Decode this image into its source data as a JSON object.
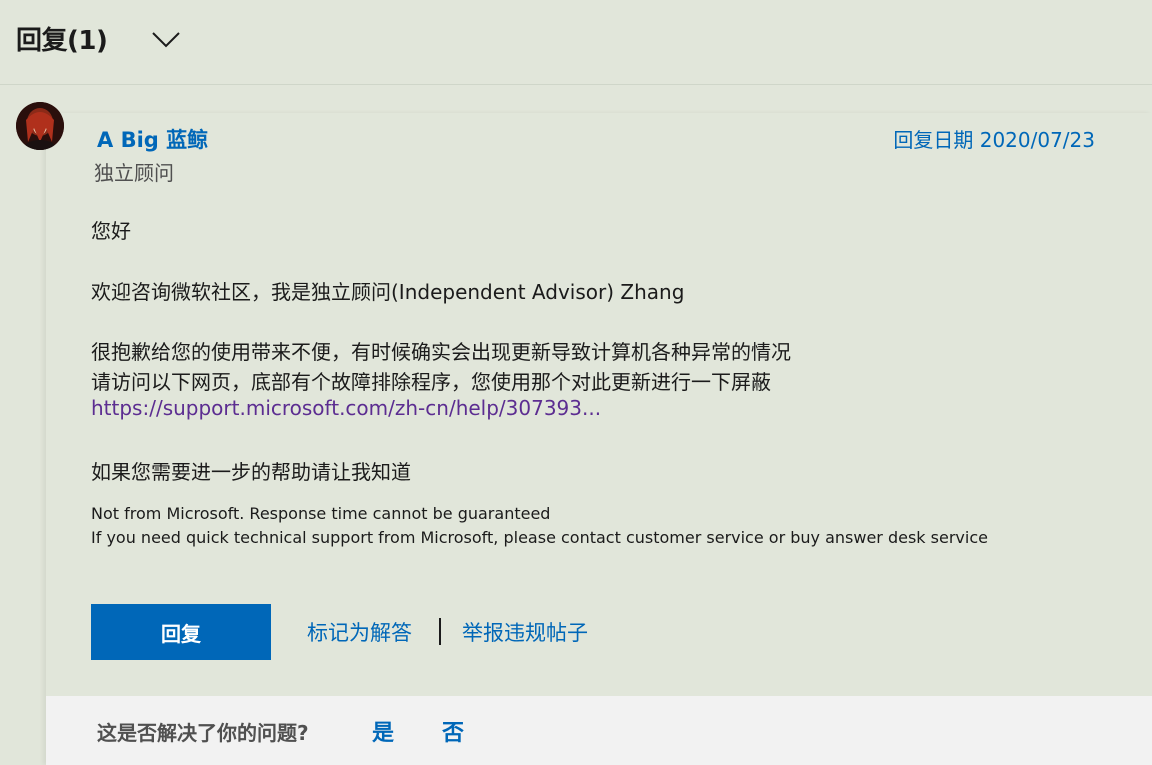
{
  "header": {
    "title": "回复(1)",
    "toggle_icon": "chevron-down-icon"
  },
  "post": {
    "author": "A Big 蓝鲸",
    "role": "独立顾问",
    "date": "回复日期 2020/07/23",
    "avatar_icon": "avatar-image",
    "lines": {
      "greeting": "您好",
      "intro": "欢迎咨询微软社区，我是独立顾问(Independent Advisor) Zhang",
      "apology": "很抱歉给您的使用带来不便，有时候确实会出现更新导致计算机各种异常的情况",
      "instruction": "请访问以下网页，底部有个故障排除程序，您使用那个对此更新进行一下屏蔽",
      "link": "https://support.microsoft.com/zh-cn/help/307393...",
      "closing": "如果您需要进一步的帮助请让我知道"
    },
    "disclaimer": {
      "line1": "Not from Microsoft. Response time cannot be guaranteed",
      "line2": "If you need quick technical support from Microsoft, please contact customer service or buy answer desk service"
    }
  },
  "actions": {
    "reply_label": "回复",
    "mark_answer_label": "标记为解答",
    "report_label": "举报违规帖子"
  },
  "feedback": {
    "question": "这是否解决了你的问题?",
    "yes_label": "是",
    "no_label": "否"
  },
  "colors": {
    "page_bg": "#e1e6da",
    "accent": "#0067b8",
    "link_visited": "#5c2d91",
    "feedback_bg": "#f2f2f2"
  }
}
